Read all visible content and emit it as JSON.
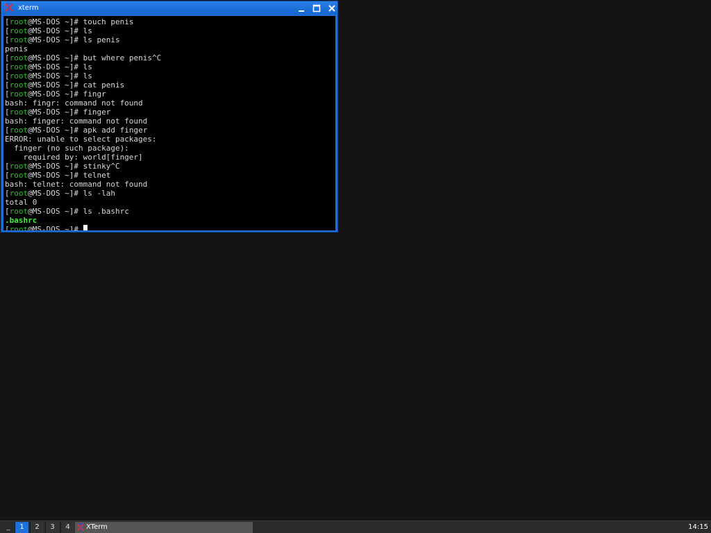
{
  "window": {
    "title": "xterm"
  },
  "prompt": {
    "user": "root",
    "host_path": "@MS-DOS ~",
    "symbol": "]#"
  },
  "terminal_lines": [
    {
      "type": "cmd",
      "text": " touch penis"
    },
    {
      "type": "cmd",
      "text": " ls"
    },
    {
      "type": "cmd",
      "text": " ls penis"
    },
    {
      "type": "out",
      "text": "penis"
    },
    {
      "type": "cmd",
      "text": " but where penis^C"
    },
    {
      "type": "cmd",
      "text": " ls"
    },
    {
      "type": "cmd",
      "text": " ls"
    },
    {
      "type": "cmd",
      "text": " cat penis"
    },
    {
      "type": "cmd",
      "text": " fingr"
    },
    {
      "type": "out",
      "text": "bash: fingr: command not found"
    },
    {
      "type": "cmd",
      "text": " finger"
    },
    {
      "type": "out",
      "text": "bash: finger: command not found"
    },
    {
      "type": "cmd",
      "text": " apk add finger"
    },
    {
      "type": "out",
      "text": "ERROR: unable to select packages:"
    },
    {
      "type": "out",
      "text": "  finger (no such package):"
    },
    {
      "type": "out",
      "text": "    required by: world[finger]"
    },
    {
      "type": "cmd",
      "text": " stinky^C"
    },
    {
      "type": "cmd",
      "text": " telnet"
    },
    {
      "type": "out",
      "text": "bash: telnet: command not found"
    },
    {
      "type": "cmd",
      "text": " ls -lah"
    },
    {
      "type": "out",
      "text": "total 0"
    },
    {
      "type": "cmd",
      "text": " ls .bashrc"
    },
    {
      "type": "green",
      "text": ".bashrc"
    },
    {
      "type": "cursor",
      "text": " "
    }
  ],
  "taskbar": {
    "menu_label": "_",
    "workspaces": [
      "1",
      "2",
      "3",
      "4"
    ],
    "active_workspace": "1",
    "task_label": "XTerm",
    "clock": "14:15"
  },
  "colors": {
    "accent": "#1c6fd8",
    "prompt_user": "#2fbf2f",
    "ls_file": "#3ff23f"
  }
}
